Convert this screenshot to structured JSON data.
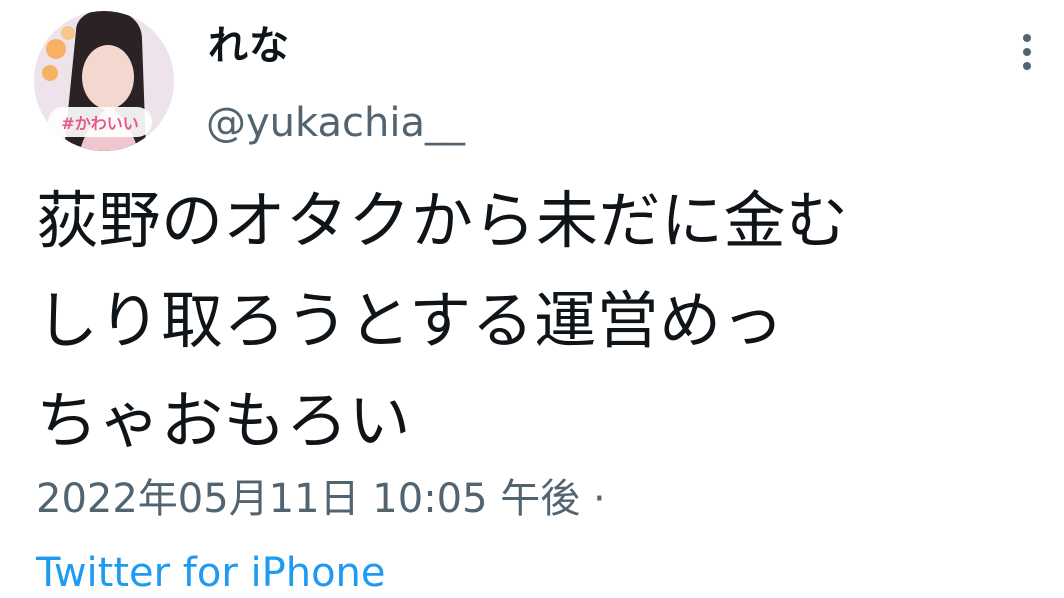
{
  "tweet": {
    "author_name": "れな",
    "author_handle": "@yukachia__",
    "avatar_caption": "#かわいい",
    "text_lines": [
      "荻野のオタクから未だに金む",
      "しり取ろうとする運営めっ",
      "ちゃおもろい"
    ],
    "timestamp": "2022年05月11日 10:05 午後 ·",
    "source": "Twitter for iPhone"
  },
  "icons": {
    "avatar": "avatar-photo",
    "more": "more-vertical-icon"
  },
  "colors": {
    "text": "#0f1419",
    "secondary": "#536471",
    "link": "#1d9bf0"
  }
}
